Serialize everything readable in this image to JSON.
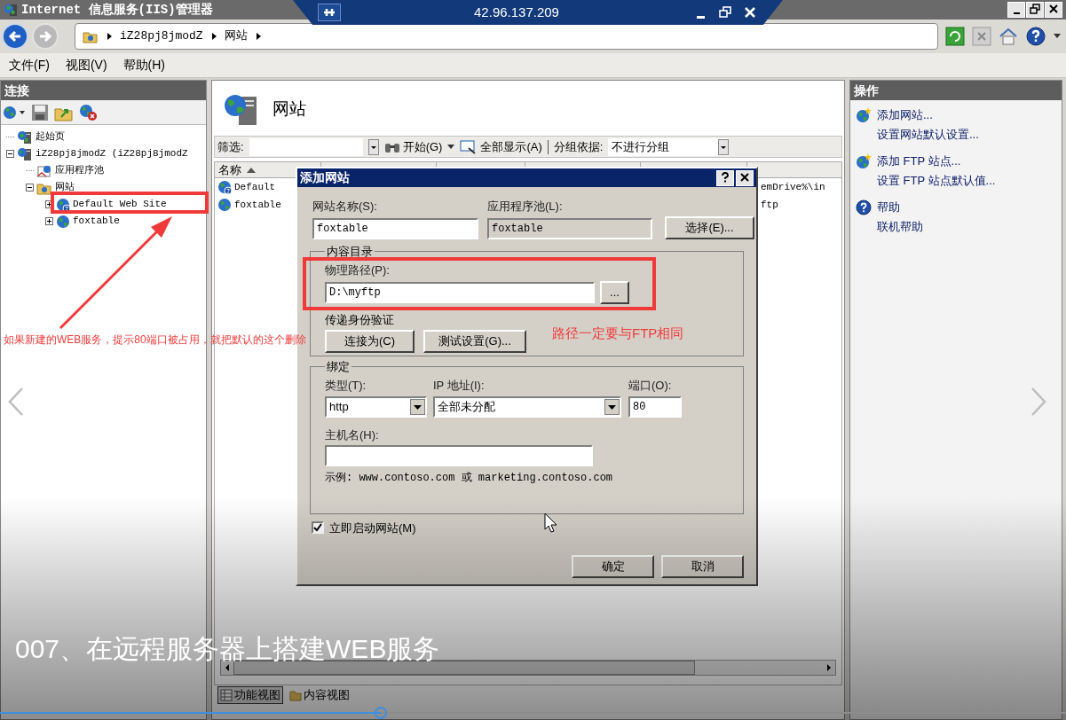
{
  "window": {
    "title": "Internet 信息服务(IIS)管理器"
  },
  "remote_bar": {
    "address": "42.96.137.209"
  },
  "address_bar": {
    "crumbs": [
      "iZ28pj8jmodZ",
      "网站"
    ]
  },
  "menu": [
    "文件(F)",
    "视图(V)",
    "帮助(H)"
  ],
  "connections": {
    "title": "连接",
    "tree": [
      {
        "kind": "home",
        "label": "起始页"
      },
      {
        "kind": "server",
        "label": "iZ28pj8jmodZ (iZ28pj8jmodZ",
        "expanded": true,
        "children": [
          {
            "kind": "pool",
            "label": "应用程序池"
          },
          {
            "kind": "folder",
            "label": "网站",
            "expanded": true,
            "children": [
              {
                "kind": "site_unknown",
                "label": "Default Web Site",
                "expanded": false
              },
              {
                "kind": "site",
                "label": "foxtable",
                "expanded": false
              }
            ]
          }
        ]
      }
    ]
  },
  "content": {
    "title": "网站",
    "filter": {
      "label": "筛选:",
      "start": "开始(G)",
      "show_all": "全部显示(A)",
      "group_label": "分组依据:",
      "group_value": "不进行分组"
    },
    "columns": [
      {
        "label": "名称",
        "sorted": true
      }
    ],
    "rows": [
      {
        "kind": "site_unknown",
        "name": "Default",
        "column_5": "emDrive%\\in"
      },
      {
        "kind": "site",
        "name": "foxtable",
        "column_5": "ftp"
      }
    ],
    "view_tabs": [
      {
        "label": "功能视图",
        "selected": true
      },
      {
        "label": "内容视图",
        "selected": false
      }
    ]
  },
  "actions": {
    "title": "操作",
    "items": [
      {
        "kind": "globe",
        "label": "添加网站..."
      },
      {
        "kind": "plain",
        "label": "设置网站默认设置..."
      },
      {
        "kind": "globe",
        "label": "添加 FTP 站点..."
      },
      {
        "kind": "plain",
        "label": "设置 FTP 站点默认值..."
      },
      {
        "kind": "help",
        "label": "帮助"
      },
      {
        "kind": "plain",
        "label": "联机帮助"
      }
    ]
  },
  "dialog": {
    "title": "添加网站",
    "site_name": {
      "label": "网站名称(S):",
      "value": "foxtable"
    },
    "app_pool": {
      "label": "应用程序池(L):",
      "value": "foxtable",
      "button": "选择(E)..."
    },
    "content_dir": {
      "legend": "内容目录",
      "path_label": "物理路径(P):",
      "path_value": "D:\\myftp",
      "browse": "...",
      "auth_label": "传递身份验证",
      "connect_as": "连接为(C)",
      "test": "测试设置(G)..."
    },
    "binding": {
      "legend": "绑定",
      "type_label": "类型(T):",
      "type_value": "http",
      "ip_label": "IP 地址(I):",
      "ip_value": "全部未分配",
      "port_label": "端口(O):",
      "port_value": "80",
      "host_label": "主机名(H):",
      "example": "示例: www.contoso.com 或 marketing.contoso.com"
    },
    "start_now": {
      "label": "立即启动网站(M)",
      "checked": true
    },
    "buttons": [
      "确定",
      "取消"
    ]
  },
  "notes": [
    {
      "text": "如果新建的WEB服务，提示80端口被占用，就把默认的这个删除"
    },
    {
      "text": "路径一定要与FTP相同"
    }
  ],
  "video": {
    "caption": "007、在远程服务器上搭建WEB服务",
    "level": 0.357
  }
}
